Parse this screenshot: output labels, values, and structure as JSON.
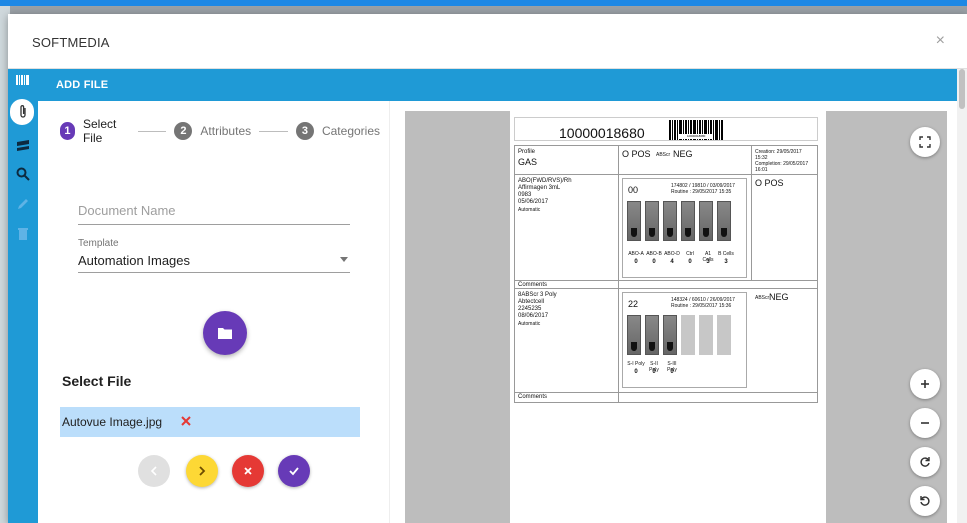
{
  "modal": {
    "title": "SOFTMEDIA",
    "close_label": "×"
  },
  "toolbar": {
    "label": "ADD FILE"
  },
  "rail_icons": [
    "barcode-icon",
    "paperclip-icon",
    "layers-icon",
    "search-icon",
    "pencil-icon",
    "trash-icon"
  ],
  "stepper": {
    "steps": [
      {
        "num": "1",
        "label": "Select File",
        "active": true
      },
      {
        "num": "2",
        "label": "Attributes",
        "active": false
      },
      {
        "num": "3",
        "label": "Categories",
        "active": false
      }
    ]
  },
  "form": {
    "document_name_placeholder": "Document Name",
    "template_label": "Template",
    "template_value": "Automation Images"
  },
  "select_file": {
    "heading": "Select File",
    "file_name": "Autovue Image.jpg"
  },
  "buttons": {
    "prev_color": "#e0e0e0",
    "next_color": "#fdd835",
    "cancel_color": "#e53935",
    "confirm_color": "#673ab7"
  },
  "preview": {
    "barcode_number": "10000018680",
    "barcode_caption": "10000018680",
    "profile_label": "Profile",
    "profile_value": "GAS",
    "blood_type": "O POS",
    "abscr_label": "ABScr",
    "abscr_result": "NEG",
    "creation": "Creation: 29/05/2017 15:32",
    "completion": "Completion: 29/05/2017 16:01",
    "test1": {
      "name": "ABO(FWD/RVS)/Rh",
      "reagent": "Affirmagen 3mL",
      "lot": "0983",
      "date": "05/06/2017",
      "mode": "Automatic",
      "score": "00",
      "line1": "174802 / 19810 / 03/09/2017",
      "line2": "Routine : 29/05/2017 15:35",
      "result": "O POS",
      "col_labels": [
        "ABO-A",
        "ABO-B",
        "ABO-D",
        "Ctrl",
        "A1 Cells",
        "B Cells"
      ],
      "col_values": [
        "0",
        "0",
        "4",
        "0",
        "3",
        "3"
      ]
    },
    "comments_label": "Comments",
    "test2": {
      "name": "8ABScr 3 Poly",
      "reagent": "Abtectcell",
      "lot": "2245235",
      "date": "08/06/2017",
      "mode": "Automatic",
      "score": "22",
      "line1": "148324 / 60610 / 26/09/2017",
      "line2": "Routine : 29/05/2017 15:36",
      "result_label": "ABScr",
      "result": "NEG",
      "col_labels": [
        "S-I Poly",
        "S-II Poly",
        "S-III Poly"
      ],
      "col_values": [
        "0",
        "0",
        "0"
      ]
    }
  },
  "zoom_controls": [
    "fullscreen-icon",
    "zoom-in-icon",
    "zoom-out-icon",
    "rotate-right-icon",
    "rotate-left-icon"
  ]
}
